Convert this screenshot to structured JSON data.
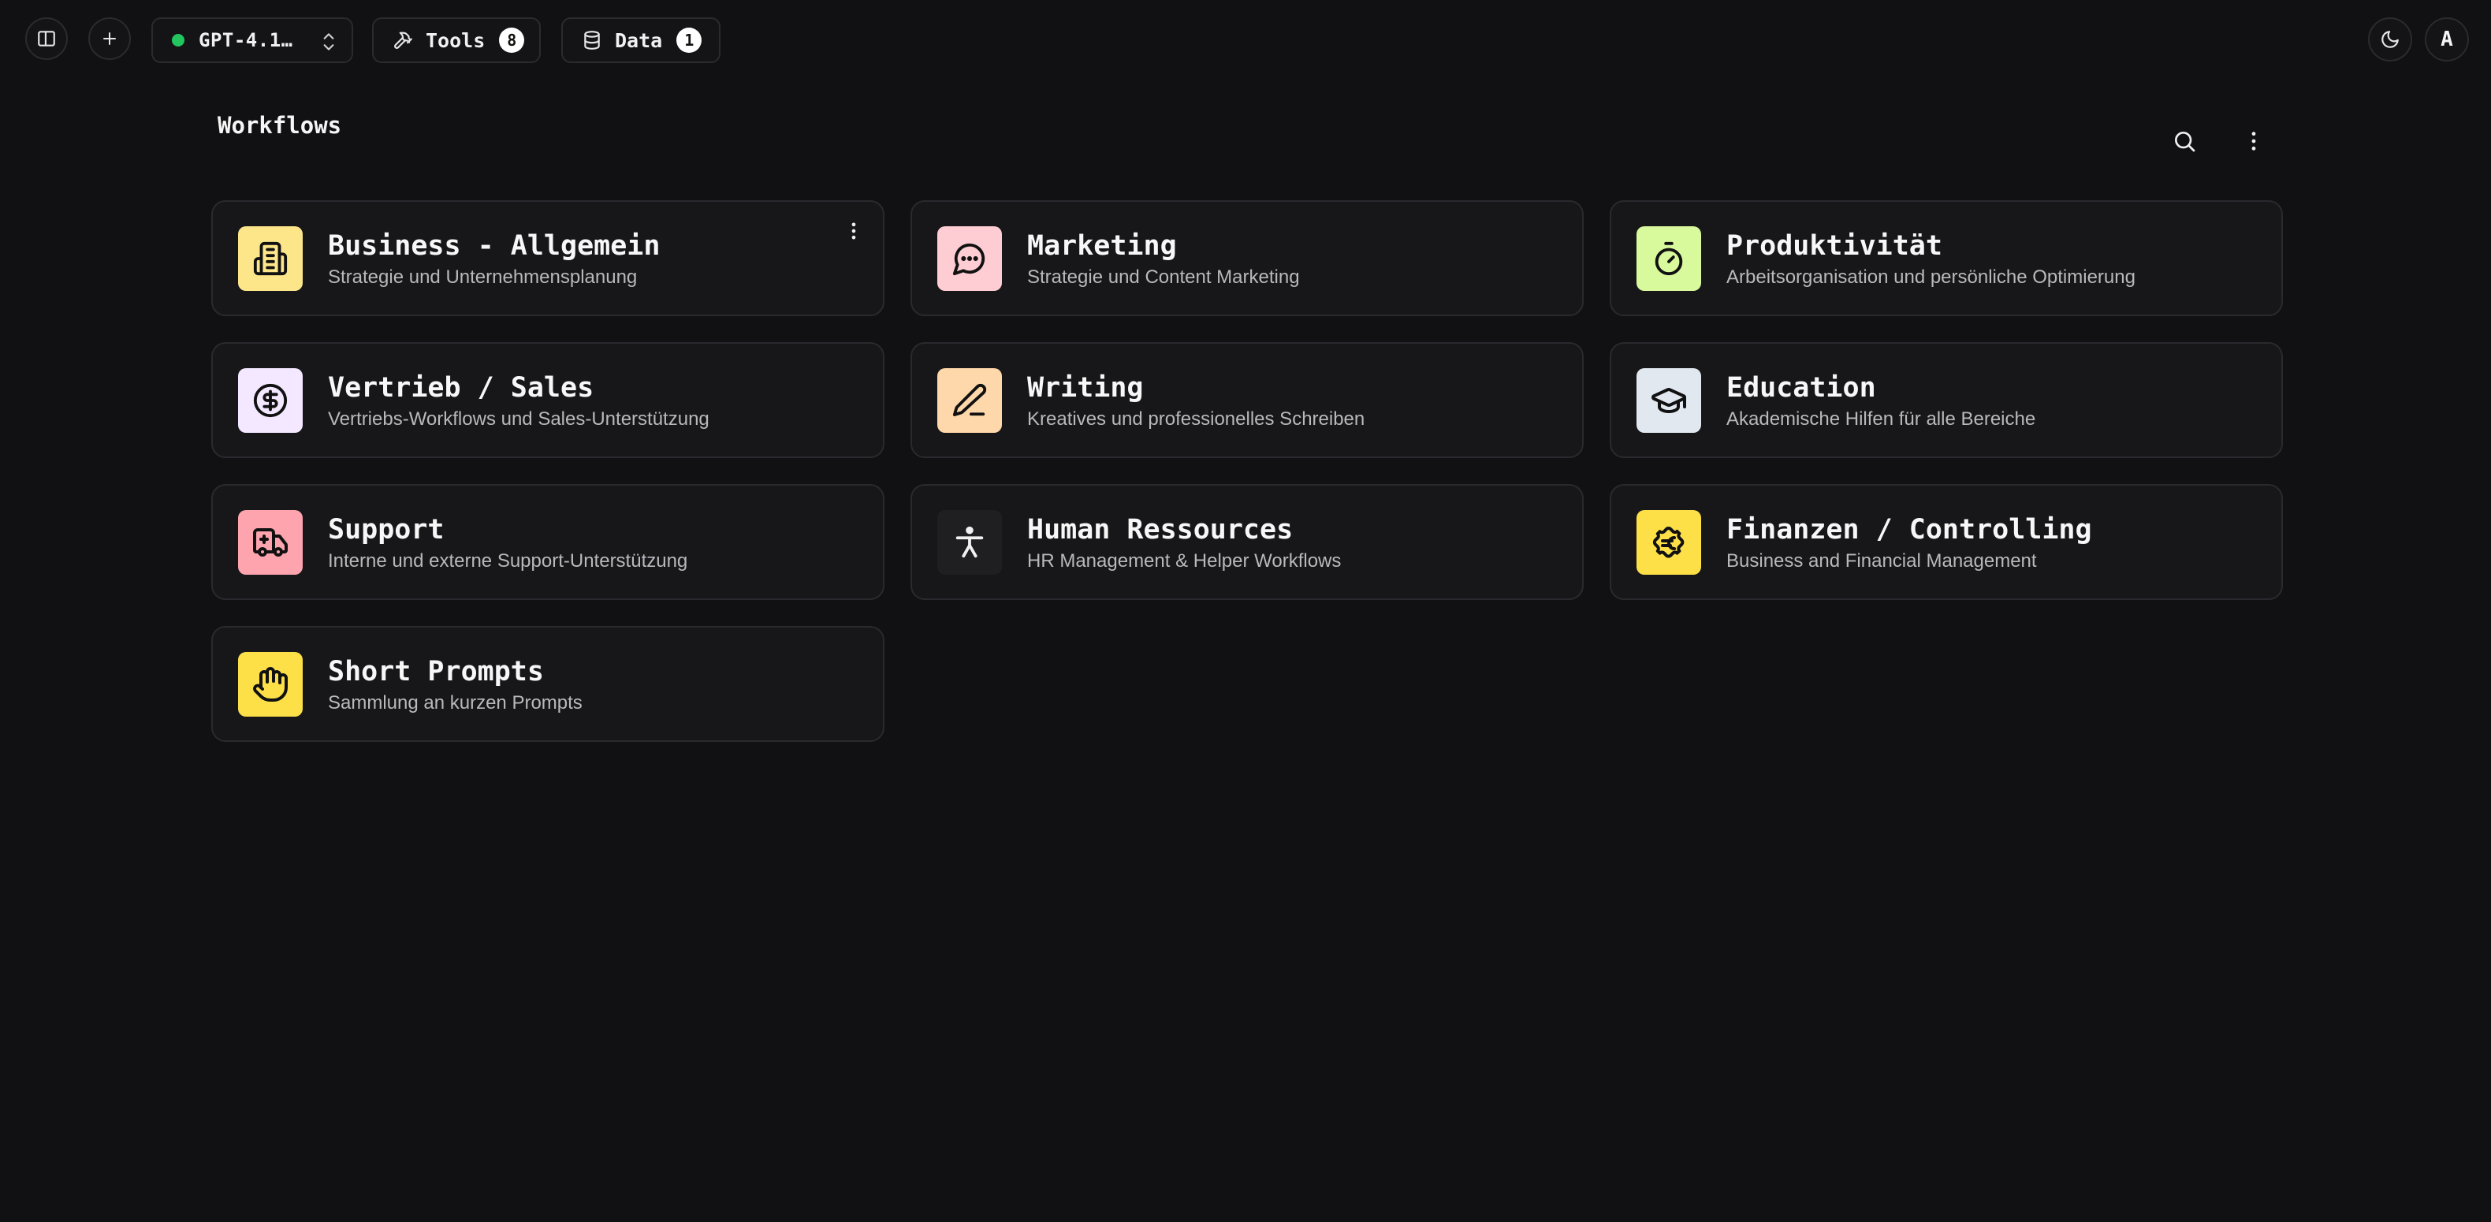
{
  "topbar": {
    "model": {
      "label": "GPT-4.1…",
      "status_color": "#22c55e"
    },
    "tools": {
      "label": "Tools",
      "count": "8"
    },
    "data": {
      "label": "Data",
      "count": "1"
    },
    "avatar": "A"
  },
  "main": {
    "title": "Workflows",
    "cards": [
      {
        "title": "Business - Allgemein",
        "desc": "Strategie und Unternehmensplanung",
        "icon": "building-icon",
        "color": "#fde68a"
      },
      {
        "title": "Marketing",
        "desc": "Strategie und Content Marketing",
        "icon": "chat-bubble-icon",
        "color": "#fecdd3"
      },
      {
        "title": "Produktivität",
        "desc": "Arbeitsorganisation und persönliche Optimierung",
        "icon": "stopwatch-icon",
        "color": "#d9f99d"
      },
      {
        "title": "Vertrieb / Sales",
        "desc": "Vertriebs-Workflows und Sales-Unterstützung",
        "icon": "dollar-circle-icon",
        "color": "#f3e8ff"
      },
      {
        "title": "Writing",
        "desc": "Kreatives und professionelles Schreiben",
        "icon": "pencil-icon",
        "color": "#fed7aa"
      },
      {
        "title": "Education",
        "desc": "Akademische Hilfen für alle Bereiche",
        "icon": "graduation-cap-icon",
        "color": "#e2e8f0"
      },
      {
        "title": "Support",
        "desc": "Interne und externe Support-Unterstützung",
        "icon": "ambulance-icon",
        "color": "#fda4af"
      },
      {
        "title": "Human Ressources",
        "desc": "HR Management & Helper Workflows",
        "icon": "person-icon",
        "color": "#1f1f22"
      },
      {
        "title": "Finanzen / Controlling",
        "desc": "Business and Financial Management",
        "icon": "euro-badge-icon",
        "color": "#fde047"
      },
      {
        "title": "Short Prompts",
        "desc": "Sammlung an kurzen Prompts",
        "icon": "hand-icon",
        "color": "#fde047"
      }
    ]
  }
}
